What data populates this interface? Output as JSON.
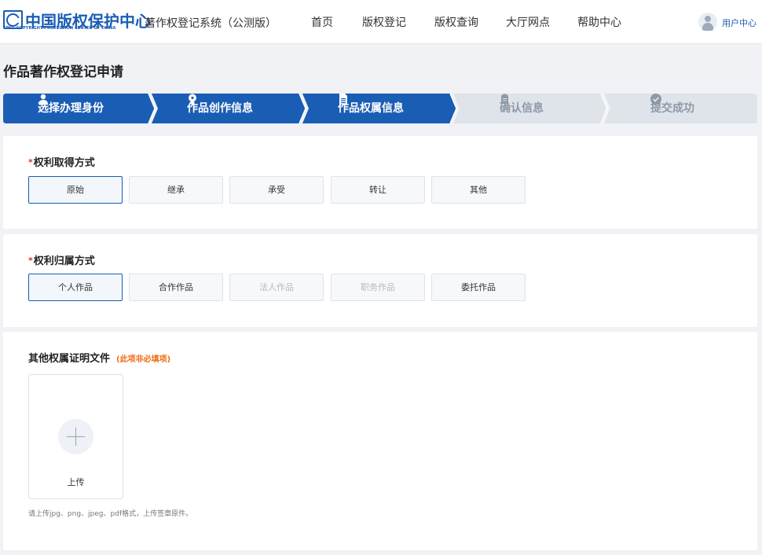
{
  "header": {
    "logo_name": "中国版权保护中心",
    "logo_subtitle": "CPCC  COPYRIGHT PROTECTION CENTER OF CHINA",
    "system_title": "著作权登记系统（公测版）",
    "nav": [
      "首页",
      "版权登记",
      "版权查询",
      "大厅网点",
      "帮助中心"
    ],
    "user_label": "用户中心"
  },
  "page_title": "作品著作权登记申请",
  "steps": [
    {
      "label": "选择办理身份",
      "icon": "user-icon",
      "state": "done"
    },
    {
      "label": "作品创作信息",
      "icon": "lightbulb-icon",
      "state": "done"
    },
    {
      "label": "作品权属信息",
      "icon": "document-icon",
      "state": "current"
    },
    {
      "label": "确认信息",
      "icon": "clipboard-icon",
      "state": "pending"
    },
    {
      "label": "提交成功",
      "icon": "check-circle-icon",
      "state": "pending"
    }
  ],
  "rights_acquisition": {
    "label": "权利取得方式",
    "required": "*",
    "options": [
      "原始",
      "继承",
      "承受",
      "转让",
      "其他"
    ],
    "selected": "原始"
  },
  "rights_ownership": {
    "label": "权利归属方式",
    "required": "*",
    "options": [
      "个人作品",
      "合作作品",
      "法人作品",
      "职务作品",
      "委托作品"
    ],
    "selected": "个人作品",
    "disabled": [
      "法人作品",
      "职务作品"
    ]
  },
  "proof_files": {
    "label": "其他权属证明文件",
    "optional_note": "(此项非必填项)",
    "upload_label": "上传",
    "hint": "请上传jpg、png、jpeg、pdf格式，上传签章原件。"
  },
  "colors": {
    "primary": "#1a5db4",
    "step_active": "#1a5db4",
    "step_inactive": "#dfe4ea",
    "required": "#e0302d",
    "optional_note": "#f06b12"
  }
}
